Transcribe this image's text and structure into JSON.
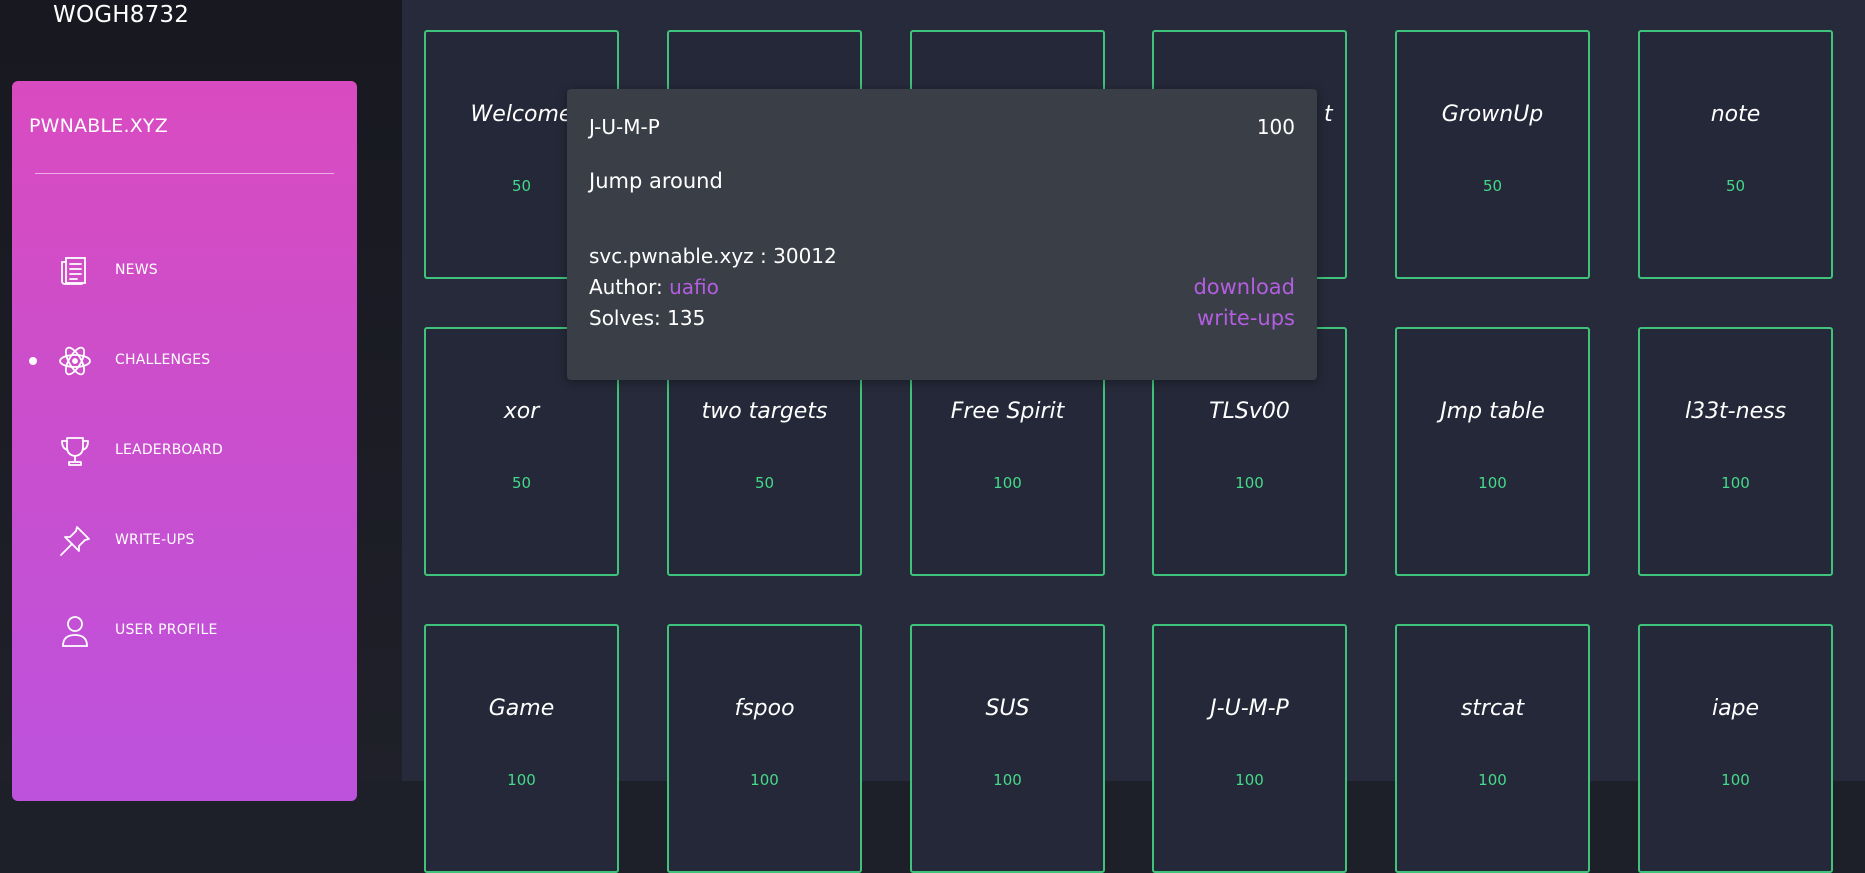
{
  "user": {
    "username": "WOGH8732"
  },
  "sidebar": {
    "brand": "PWNABLE.XYZ",
    "items": [
      {
        "label": "NEWS",
        "icon": "news-icon",
        "active": false
      },
      {
        "label": "CHALLENGES",
        "icon": "atom-icon",
        "active": true
      },
      {
        "label": "LEADERBOARD",
        "icon": "trophy-icon",
        "active": false
      },
      {
        "label": "WRITE-UPS",
        "icon": "pin-icon",
        "active": false
      },
      {
        "label": "USER PROFILE",
        "icon": "user-icon",
        "active": false
      }
    ]
  },
  "challenges": [
    {
      "name": "Welcome",
      "points": "50"
    },
    {
      "name": "",
      "points": ""
    },
    {
      "name": "",
      "points": ""
    },
    {
      "name": "t",
      "points": ""
    },
    {
      "name": "GrownUp",
      "points": "50"
    },
    {
      "name": "note",
      "points": "50"
    },
    {
      "name": "xor",
      "points": "50"
    },
    {
      "name": "two targets",
      "points": "50"
    },
    {
      "name": "Free Spirit",
      "points": "100"
    },
    {
      "name": "TLSv00",
      "points": "100"
    },
    {
      "name": "Jmp table",
      "points": "100"
    },
    {
      "name": "l33t-ness",
      "points": "100"
    },
    {
      "name": "Game",
      "points": "100"
    },
    {
      "name": "fspoo",
      "points": "100"
    },
    {
      "name": "SUS",
      "points": "100"
    },
    {
      "name": "J-U-M-P",
      "points": "100"
    },
    {
      "name": "strcat",
      "points": "100"
    },
    {
      "name": "iape",
      "points": "100"
    }
  ],
  "popup": {
    "title": "J-U-M-P",
    "points": "100",
    "description": "Jump around",
    "server": "svc.pwnable.xyz : 30012",
    "author_label": "Author:",
    "author": "uafio",
    "solves": "Solves: 135",
    "download": "download",
    "writeups": "write-ups"
  },
  "colors": {
    "accent_green": "#45d98a",
    "link_purple": "#b35ee0",
    "sidebar_gradient_top": "#d94bc0",
    "sidebar_gradient_bottom": "#bd52dd"
  }
}
